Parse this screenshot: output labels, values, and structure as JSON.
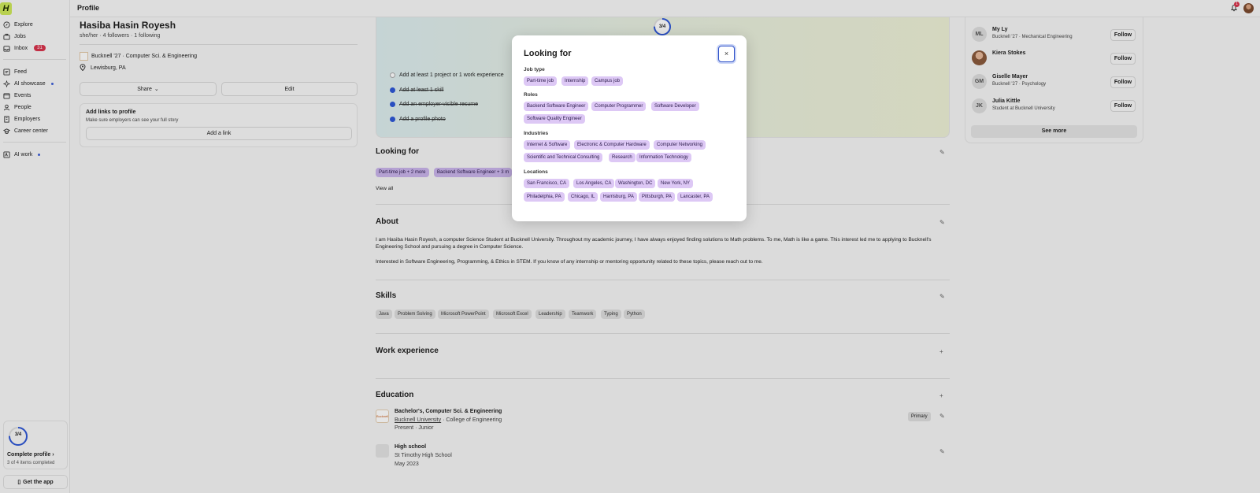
{
  "app": {
    "logo_text": "H",
    "page_title": "Profile",
    "notification_count": "1"
  },
  "sidebar": {
    "items": [
      {
        "label": "Explore",
        "icon": "compass-icon"
      },
      {
        "label": "Jobs",
        "icon": "briefcase-icon"
      },
      {
        "label": "Inbox",
        "icon": "inbox-icon",
        "badge": "31"
      },
      {
        "label": "Feed",
        "icon": "feed-icon"
      },
      {
        "label": "AI showcase",
        "icon": "sparkle-icon"
      },
      {
        "label": "Events",
        "icon": "calendar-icon"
      },
      {
        "label": "People",
        "icon": "people-icon"
      },
      {
        "label": "Employers",
        "icon": "building-icon"
      },
      {
        "label": "Career center",
        "icon": "career-icon"
      },
      {
        "label": "AI work",
        "icon": "ai-work-icon"
      }
    ],
    "progress": {
      "value": "3/4",
      "fraction": 0.75,
      "label": "Complete profile",
      "sub": "3 of 4 items completed"
    },
    "get_app": "Get the app"
  },
  "profile": {
    "name": "Hasiba Hasin Royesh",
    "pronouns": "she/her",
    "followers": "4 followers",
    "following": "1 following",
    "edu": "Bucknell '27 · Computer Sci. & Engineering",
    "location": "Lewisburg, PA",
    "share": "Share",
    "edit": "Edit",
    "links_title": "Add links to profile",
    "links_sub": "Make sure employers can see your full story",
    "add_link": "Add a link"
  },
  "hero": {
    "progress": "3/4",
    "tasks": [
      {
        "label": "Add at least 1 project or 1 work experience",
        "done": false
      },
      {
        "label": "Add at least 1 skill",
        "done": true
      },
      {
        "label": "Add an employer-visible resume",
        "done": true
      },
      {
        "label": "Add a profile photo",
        "done": true
      }
    ]
  },
  "looking_for": {
    "title": "Looking for",
    "chips": [
      "Part-time job + 2 more",
      "Backend Software Engineer + 3 m"
    ],
    "view_all": "View all"
  },
  "about": {
    "title": "About",
    "para1": "I am Hasiba Hasin Royesh, a computer Science Student at Bucknell University. Throughout my academic journey, I have always enjoyed finding solutions to Math problems. To me, Math is like a game. This interest led me to applying to Bucknell's Engineering School and pursuing a degree in Computer Science.",
    "para2": "Interested in Software Engineering, Programming, & Ethics in STEM. If you know of any internship or mentoring opportunity related to these topics, please reach out to me."
  },
  "skills": {
    "title": "Skills",
    "items": [
      "Java",
      "Problem Solving",
      "Microsoft PowerPoint",
      "Microsoft Excel",
      "Leadership",
      "Teamwork",
      "Typing",
      "Python"
    ]
  },
  "work": {
    "title": "Work experience"
  },
  "education": {
    "title": "Education",
    "entries": [
      {
        "degree": "Bachelor's, Computer Sci. & Engineering",
        "school": "Bucknell University",
        "college": " · College of Engineering",
        "dates": "Present · Junior",
        "badge": "Primary",
        "logo": "Bucknell"
      },
      {
        "degree": "High school",
        "school": "St Timothy High School",
        "dates": "May 2023"
      }
    ]
  },
  "people": {
    "items": [
      {
        "initials": "ML",
        "name": "My Ly",
        "role": "Bucknell '27 · Mechanical Engineering",
        "follow": "Follow"
      },
      {
        "initials": "",
        "name": "Kiera Stokes",
        "role": "",
        "follow": "Follow"
      },
      {
        "initials": "GM",
        "name": "Giselle Mayer",
        "role": "Bucknell '27 · Psychology",
        "follow": "Follow"
      },
      {
        "initials": "JK",
        "name": "Julia Kittle",
        "role": "Student at Bucknell University",
        "follow": "Follow"
      }
    ],
    "see_more": "See more"
  },
  "modal": {
    "title": "Looking for",
    "close": "×",
    "groups": [
      {
        "label": "Job type",
        "chips": [
          "Part-time job",
          "Internship",
          "Campus job"
        ]
      },
      {
        "label": "Roles",
        "chips": [
          "Backend Software Engineer",
          "Computer Programmer",
          "Software Developer",
          "Software Quality Engineer"
        ]
      },
      {
        "label": "Industries",
        "chips": [
          "Internet & Software",
          "Electronic & Computer Hardware",
          "Computer Networking",
          "Scientific and Technical Consulting",
          "Research",
          "Information Technology"
        ]
      },
      {
        "label": "Locations",
        "chips": [
          "San Francisco, CA",
          "Los Angeles, CA",
          "Washington, DC",
          "New York, NY",
          "Philadelphia, PA",
          "Chicago, IL",
          "Harrisburg, PA",
          "Pittsburgh, PA",
          "Lancaster, PA"
        ]
      }
    ]
  },
  "colors": {
    "brand": "#cde85a",
    "accent": "#2e57d6",
    "badge": "#d8344c",
    "chip": "#ddc8f5"
  }
}
